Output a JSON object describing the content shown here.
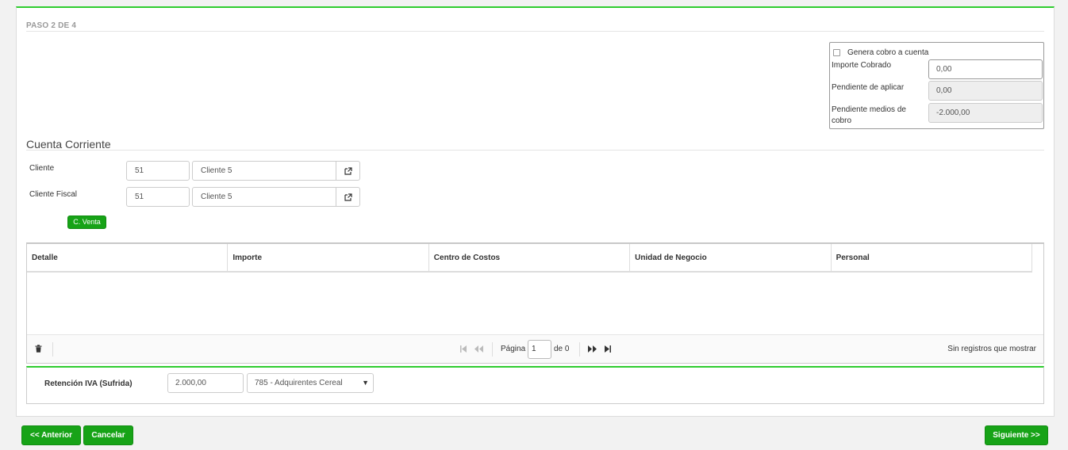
{
  "step": {
    "title": "PASO 2 DE 4"
  },
  "cobro": {
    "checkbox_label": "Genera cobro a cuenta",
    "fields": [
      {
        "label": "Importe Cobrado",
        "value": "0,00"
      },
      {
        "label": "Pendiente de aplicar",
        "value": "0,00"
      },
      {
        "label": "Pendiente medios de cobro",
        "value": "-2.000,00"
      }
    ]
  },
  "cuenta": {
    "title": "Cuenta Corriente",
    "cliente": {
      "label": "Cliente",
      "code": "51",
      "name": "Cliente 5"
    },
    "cliente_fiscal": {
      "label": "Cliente Fiscal",
      "code": "51",
      "name": "Cliente 5"
    },
    "cventa_label": "C. Venta"
  },
  "grid": {
    "columns": [
      "Detalle",
      "Importe",
      "Centro de Costos",
      "Unidad de Negocio",
      "Personal"
    ],
    "page_label": "Página",
    "page_value": "1",
    "of_label": "de 0",
    "empty_text": "Sin registros que mostrar"
  },
  "retencion": {
    "label": "Retención IVA (Sufrida)",
    "amount": "2.000,00",
    "selected": "785 - Adquirentes Cereal"
  },
  "footer": {
    "prev_label": "<< Anterior",
    "cancel_label": "Cancelar",
    "next_label": "Siguiente >>"
  },
  "colors": {
    "accent": "#17a317",
    "top_border": "#2ecc2e"
  }
}
